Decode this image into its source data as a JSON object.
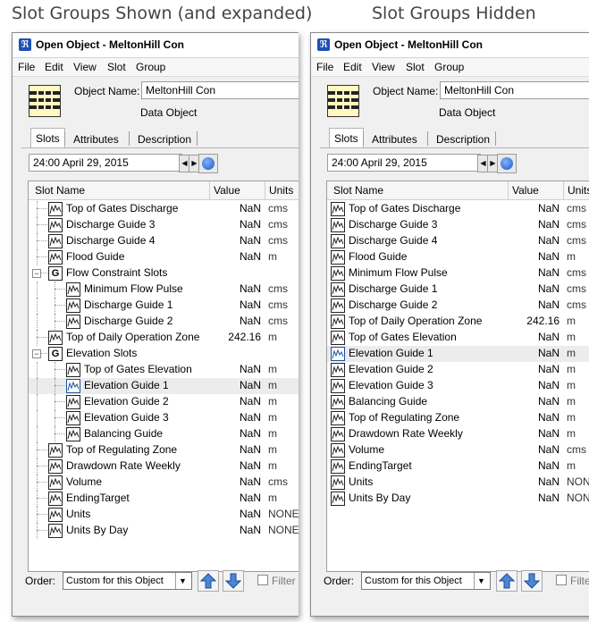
{
  "captions": {
    "left": "Slot Groups Shown (and expanded)",
    "right": "Slot Groups Hidden"
  },
  "window": {
    "title": "Open Object - MeltonHill Con",
    "menu": [
      "File",
      "Edit",
      "View",
      "Slot",
      "Group"
    ],
    "object_name_label": "Object Name:",
    "object_name_value": "MeltonHill Con",
    "object_type": "Data Object",
    "tabs": [
      "Slots",
      "Attributes",
      "Description"
    ],
    "active_tab": "Slots",
    "date": "24:00 April 29, 2015",
    "columns": {
      "name": "Slot Name",
      "value": "Value",
      "units": "Units"
    },
    "order_label": "Order:",
    "order_value": "Custom for this Object",
    "filter_label": "Filter"
  },
  "left_rows": [
    {
      "name": "Top of Gates Discharge",
      "value": "NaN",
      "units": "cms",
      "level": 1,
      "type": "slot"
    },
    {
      "name": "Discharge Guide 3",
      "value": "NaN",
      "units": "cms",
      "level": 1,
      "type": "slot"
    },
    {
      "name": "Discharge Guide 4",
      "value": "NaN",
      "units": "cms",
      "level": 1,
      "type": "slot"
    },
    {
      "name": "Flood Guide",
      "value": "NaN",
      "units": "m",
      "level": 1,
      "type": "slot"
    },
    {
      "name": "Flow Constraint Slots",
      "value": "",
      "units": "",
      "level": 1,
      "type": "group"
    },
    {
      "name": "Minimum Flow Pulse",
      "value": "NaN",
      "units": "cms",
      "level": 2,
      "type": "slot"
    },
    {
      "name": "Discharge Guide 1",
      "value": "NaN",
      "units": "cms",
      "level": 2,
      "type": "slot"
    },
    {
      "name": "Discharge Guide 2",
      "value": "NaN",
      "units": "cms",
      "level": 2,
      "type": "slot"
    },
    {
      "name": "Top of Daily Operation Zone",
      "value": "242.16",
      "units": "m",
      "level": 1,
      "type": "slot"
    },
    {
      "name": "Elevation Slots",
      "value": "",
      "units": "",
      "level": 1,
      "type": "group"
    },
    {
      "name": "Top of Gates Elevation",
      "value": "NaN",
      "units": "m",
      "level": 2,
      "type": "slot"
    },
    {
      "name": "Elevation Guide 1",
      "value": "NaN",
      "units": "m",
      "level": 2,
      "type": "slot",
      "selected": true
    },
    {
      "name": "Elevation Guide 2",
      "value": "NaN",
      "units": "m",
      "level": 2,
      "type": "slot"
    },
    {
      "name": "Elevation Guide 3",
      "value": "NaN",
      "units": "m",
      "level": 2,
      "type": "slot"
    },
    {
      "name": "Balancing Guide",
      "value": "NaN",
      "units": "m",
      "level": 2,
      "type": "slot"
    },
    {
      "name": "Top of Regulating Zone",
      "value": "NaN",
      "units": "m",
      "level": 1,
      "type": "slot"
    },
    {
      "name": "Drawdown Rate Weekly",
      "value": "NaN",
      "units": "m",
      "level": 1,
      "type": "slot"
    },
    {
      "name": "Volume",
      "value": "NaN",
      "units": "cms",
      "level": 1,
      "type": "slot"
    },
    {
      "name": "EndingTarget",
      "value": "NaN",
      "units": "m",
      "level": 1,
      "type": "slot"
    },
    {
      "name": "Units",
      "value": "NaN",
      "units": "NONE",
      "level": 1,
      "type": "slot"
    },
    {
      "name": "Units By Day",
      "value": "NaN",
      "units": "NONE",
      "level": 1,
      "type": "slot"
    }
  ],
  "right_rows": [
    {
      "name": "Top of Gates Discharge",
      "value": "NaN",
      "units": "cms"
    },
    {
      "name": "Discharge Guide 3",
      "value": "NaN",
      "units": "cms"
    },
    {
      "name": "Discharge Guide 4",
      "value": "NaN",
      "units": "cms"
    },
    {
      "name": "Flood Guide",
      "value": "NaN",
      "units": "m"
    },
    {
      "name": "Minimum Flow Pulse",
      "value": "NaN",
      "units": "cms"
    },
    {
      "name": "Discharge Guide 1",
      "value": "NaN",
      "units": "cms"
    },
    {
      "name": "Discharge Guide 2",
      "value": "NaN",
      "units": "cms"
    },
    {
      "name": "Top of Daily Operation Zone",
      "value": "242.16",
      "units": "m"
    },
    {
      "name": "Top of Gates Elevation",
      "value": "NaN",
      "units": "m"
    },
    {
      "name": "Elevation Guide 1",
      "value": "NaN",
      "units": "m",
      "selected": true
    },
    {
      "name": "Elevation Guide 2",
      "value": "NaN",
      "units": "m"
    },
    {
      "name": "Elevation Guide 3",
      "value": "NaN",
      "units": "m"
    },
    {
      "name": "Balancing Guide",
      "value": "NaN",
      "units": "m"
    },
    {
      "name": "Top of Regulating Zone",
      "value": "NaN",
      "units": "m"
    },
    {
      "name": "Drawdown Rate Weekly",
      "value": "NaN",
      "units": "m"
    },
    {
      "name": "Volume",
      "value": "NaN",
      "units": "cms"
    },
    {
      "name": "EndingTarget",
      "value": "NaN",
      "units": "m"
    },
    {
      "name": "Units",
      "value": "NaN",
      "units": "NONE"
    },
    {
      "name": "Units By Day",
      "value": "NaN",
      "units": "NONE"
    }
  ],
  "icons": {
    "app": "riverware-app-icon",
    "object": "data-object-grid-icon",
    "slot": "timeseries-slot-icon",
    "group": "slot-group-icon",
    "globe": "globe-icon",
    "up": "move-up-arrow-icon",
    "down": "move-down-arrow-icon"
  },
  "colors": {
    "accent": "#1e4fb4",
    "selection": "#ececec",
    "object_icon_fill": "#fff8c0"
  }
}
